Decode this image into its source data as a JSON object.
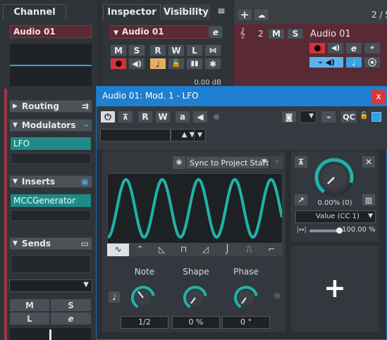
{
  "left_panel": {
    "tab": "Channel",
    "track_name": "Audio 01",
    "sections": {
      "routing": "Routing",
      "modulators": "Modulators",
      "inserts": "Inserts",
      "sends": "Sends"
    },
    "modulator_slot": "LFO",
    "insert_slot": "MCCGenerator",
    "mini_buttons": [
      "M",
      "S",
      "L",
      "e"
    ]
  },
  "inspector": {
    "tabs": [
      "Inspector",
      "Visibility"
    ],
    "track_name": "Audio 01",
    "buttons_row1": [
      "M",
      "S",
      "R",
      "W",
      "L"
    ],
    "volume_readout": "0.00 dB"
  },
  "project": {
    "track_number": "2",
    "track_name": "Audio 01",
    "buttons": [
      "M",
      "S"
    ],
    "counter": "2 / 5"
  },
  "lfo_window": {
    "title": "Audio 01: Mod. 1 - LFO",
    "toolbar_buttons": [
      "R",
      "W",
      "a"
    ],
    "qc_label": "QC",
    "sync_label": "Sync to Project Start",
    "knobs": [
      {
        "label": "Note",
        "value": "1/2"
      },
      {
        "label": "Shape",
        "value": "0 %"
      },
      {
        "label": "Phase",
        "value": "0 °"
      }
    ],
    "output": {
      "percent_text": "0.00% (0)",
      "target": "Value (CC 1)",
      "depth_text": "100.00 %"
    },
    "colors": {
      "accent": "#1fb3a8",
      "title_bar": "#1f7fd1",
      "record": "#e0303a",
      "close": "#d9383a"
    },
    "waveforms": [
      "sine-icon",
      "triangle-icon",
      "saw-down-icon",
      "square-icon",
      "saw-up-icon",
      "exp-curve-icon",
      "pulse-icon",
      "step-icon"
    ]
  }
}
